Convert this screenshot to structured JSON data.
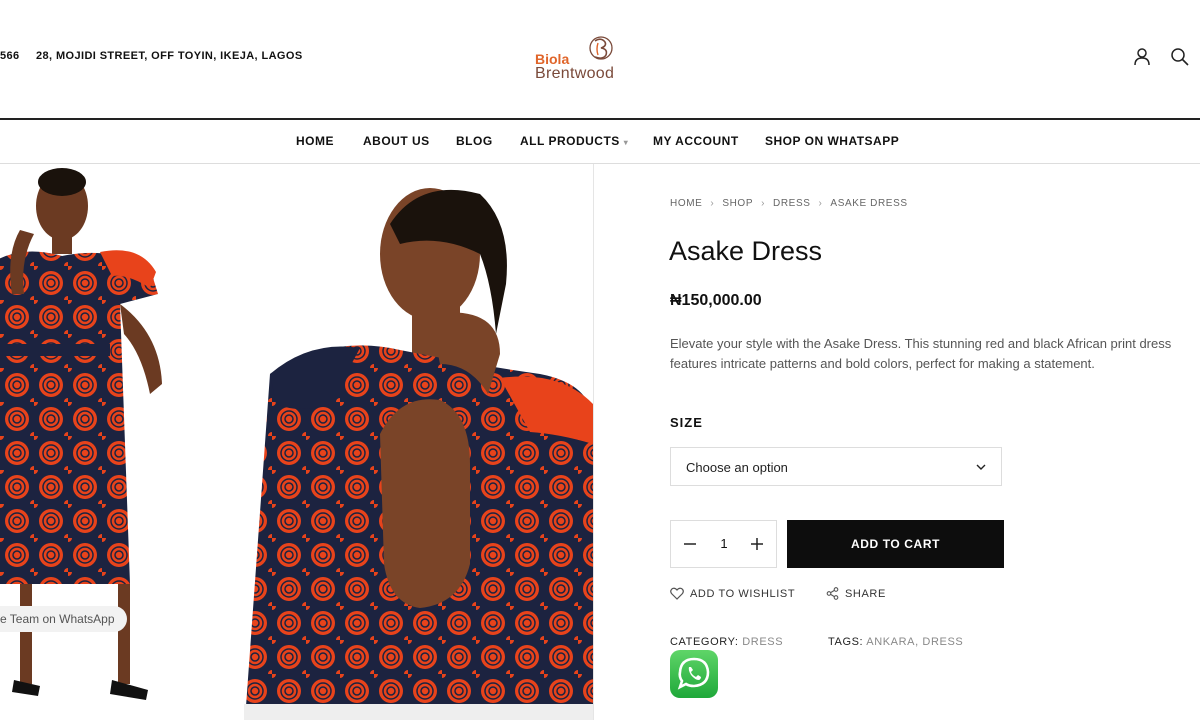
{
  "header": {
    "phone_partial": "566",
    "address": "28, MOJIDI STREET, OFF TOYIN, IKEJA, LAGOS",
    "logo": {
      "line1": "Biola",
      "line2": "Brentwood"
    },
    "icons": [
      "user-icon",
      "search-icon"
    ]
  },
  "nav": {
    "items": [
      {
        "label": "HOME"
      },
      {
        "label": "ABOUT US"
      },
      {
        "label": "BLOG"
      },
      {
        "label": "ALL PRODUCTS",
        "has_dropdown": true
      },
      {
        "label": "MY ACCOUNT"
      },
      {
        "label": "SHOP ON WHATSAPP"
      }
    ]
  },
  "gallery": {
    "whatsapp_chat_label": "e Team on WhatsApp"
  },
  "breadcrumb": [
    "HOME",
    "SHOP",
    "DRESS",
    "ASAKE DRESS"
  ],
  "product": {
    "title": "Asake Dress",
    "price": "₦150,000.00",
    "description": "Elevate your style with the Asake Dress. This stunning red and black African print dress features intricate patterns and bold colors, perfect for making a statement.",
    "size_label": "SIZE",
    "size_placeholder": "Choose an option",
    "quantity": "1",
    "add_to_cart": "ADD TO CART",
    "wishlist": "ADD TO WISHLIST",
    "share": "SHARE",
    "category_label": "CATEGORY:",
    "category_value": "DRESS",
    "tags_label": "TAGS:",
    "tags_value": "ANKARA, DRESS"
  },
  "colors": {
    "accent_orange": "#e0652a",
    "button_dark": "#0d0d0d",
    "whatsapp_green": "#25d366",
    "dress_red": "#e8431b",
    "dress_navy": "#1c2340"
  }
}
